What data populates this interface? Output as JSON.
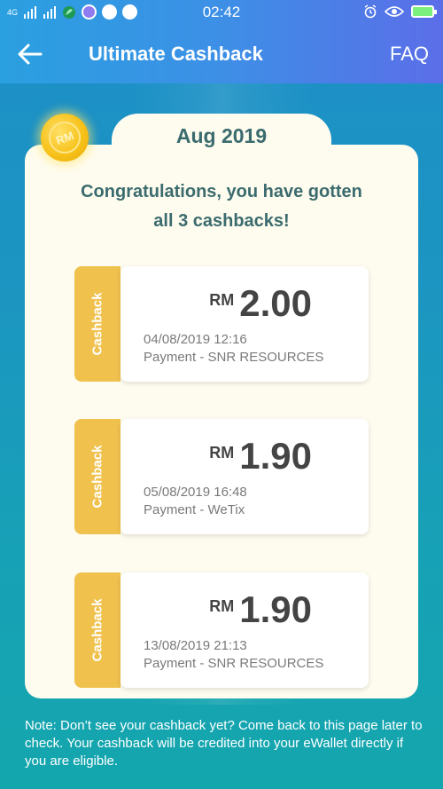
{
  "status_bar": {
    "network_label": "4G",
    "time": "02:42"
  },
  "header": {
    "title": "Ultimate Cashback",
    "faq_label": "FAQ"
  },
  "coin_label": "RM",
  "month_label": "Aug 2019",
  "congrats_line1": "Congratulations, you have gotten",
  "congrats_line2": "all 3 cashbacks!",
  "cashbacks": [
    {
      "tag": "Cashback",
      "currency": "RM",
      "amount": "2.00",
      "datetime": "04/08/2019 12:16",
      "description": "Payment - SNR RESOURCES"
    },
    {
      "tag": "Cashback",
      "currency": "RM",
      "amount": "1.90",
      "datetime": "05/08/2019 16:48",
      "description": "Payment - WeTix"
    },
    {
      "tag": "Cashback",
      "currency": "RM",
      "amount": "1.90",
      "datetime": "13/08/2019 21:13",
      "description": "Payment - SNR RESOURCES"
    }
  ],
  "note": "Note: Don’t see your cashback yet? Come back to this page later to check. Your cashback will be credited into your eWallet directly if you are eligible.",
  "colors": {
    "header_start": "#2aa0e0",
    "header_end": "#5b6ee8",
    "card_bg": "#fefcef",
    "ribbon": "#f0c14d",
    "heading_text": "#3b6b6e"
  }
}
